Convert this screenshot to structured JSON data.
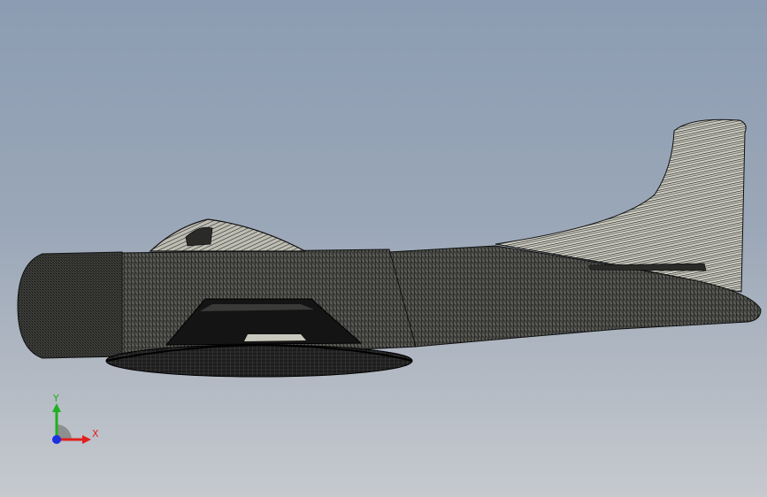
{
  "viewport": {
    "background_top": "#8c9cb2",
    "background_bottom": "#c6cacf"
  },
  "model": {
    "render_style": "wireframe mesh",
    "mesh_color": "#1a1a1a",
    "surface_color": "#cfcfc4"
  },
  "triad": {
    "x_label": "X",
    "y_label": "Y",
    "x_color": "#e02020",
    "y_color": "#20b020",
    "z_color": "#1a30e0"
  }
}
